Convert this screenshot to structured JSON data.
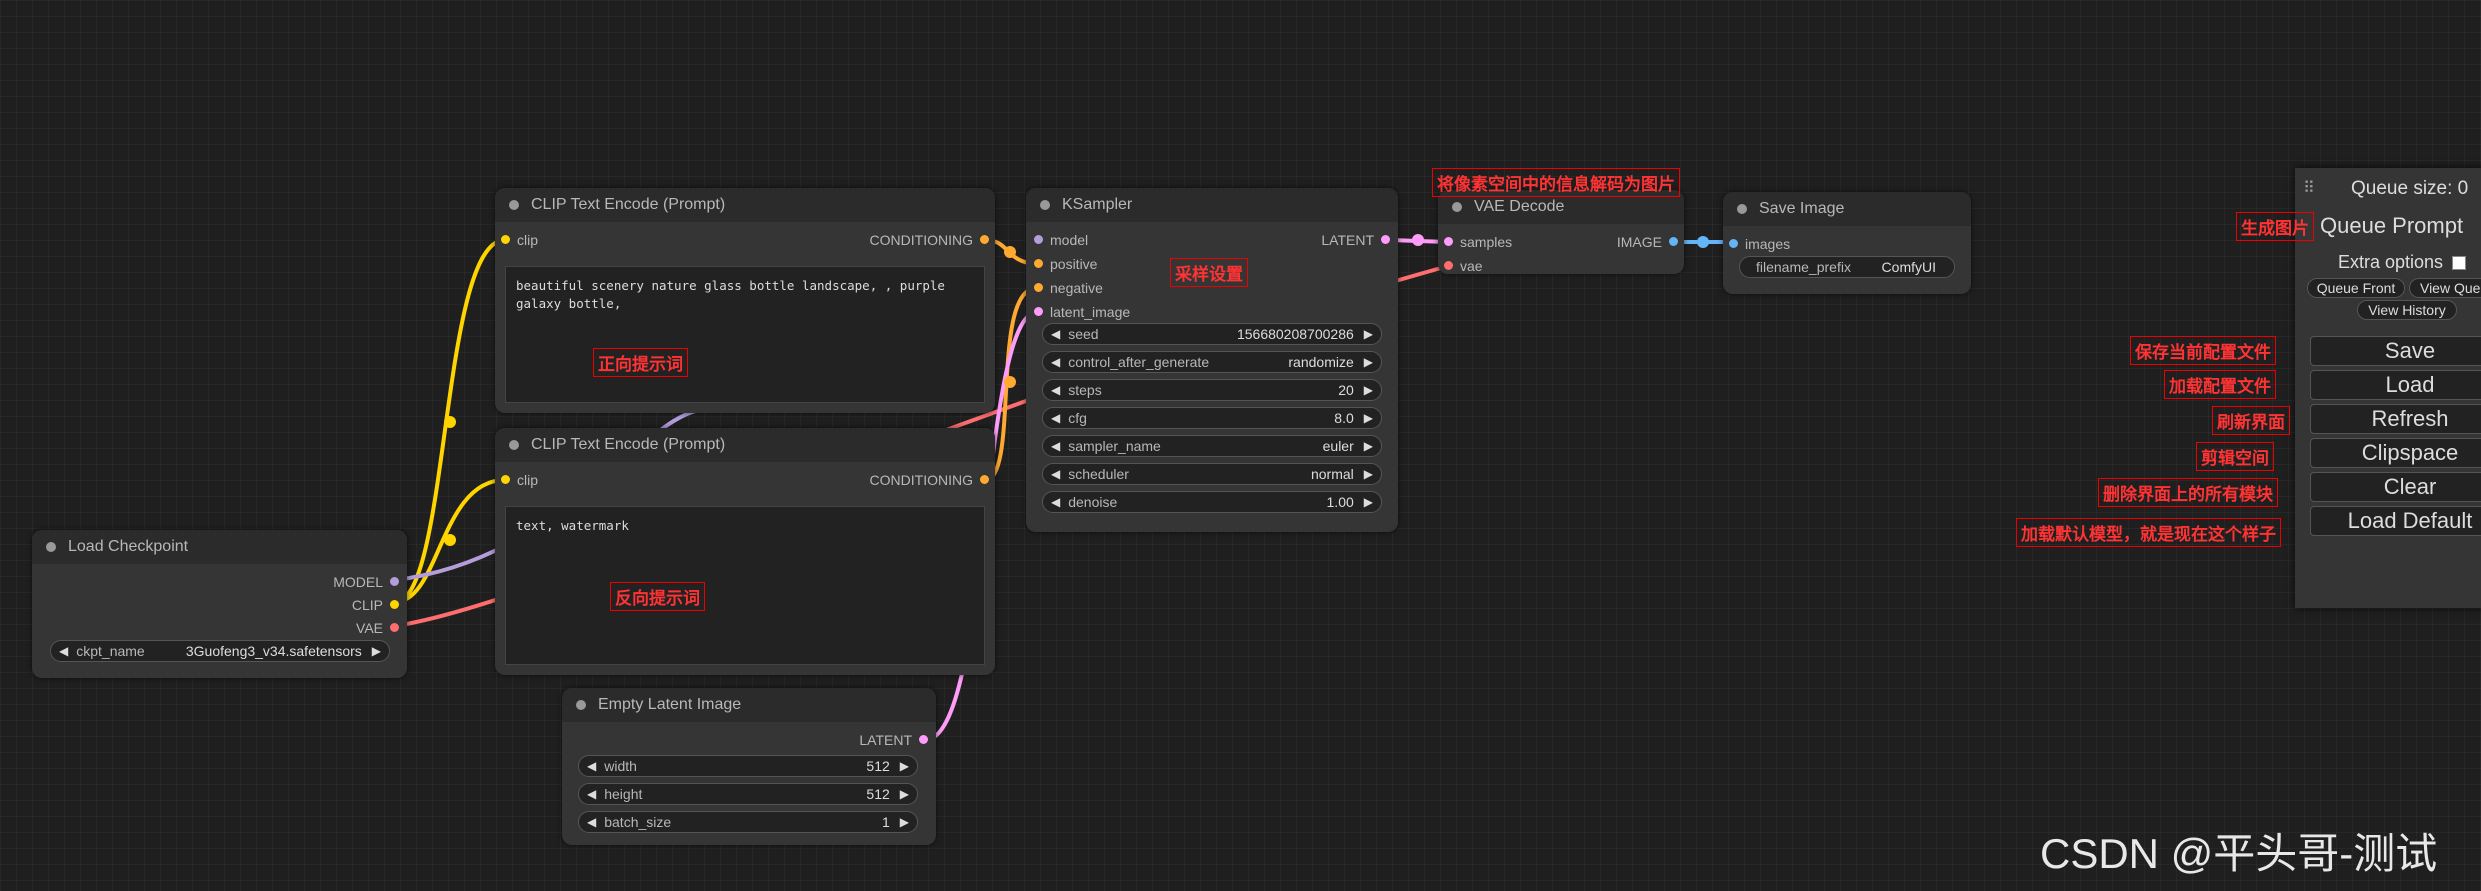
{
  "nodes": {
    "load_checkpoint": {
      "title": "Load Checkpoint",
      "outputs": [
        "MODEL",
        "CLIP",
        "VAE"
      ],
      "ckpt_label": "ckpt_name",
      "ckpt_value": "3Guofeng3_v34.safetensors"
    },
    "clip_pos": {
      "title": "CLIP Text Encode (Prompt)",
      "input": "clip",
      "output": "CONDITIONING",
      "text": "beautiful scenery nature glass bottle landscape, , purple galaxy bottle,"
    },
    "clip_neg": {
      "title": "CLIP Text Encode (Prompt)",
      "input": "clip",
      "output": "CONDITIONING",
      "text": "text, watermark"
    },
    "ksampler": {
      "title": "KSampler",
      "inputs": [
        "model",
        "positive",
        "negative",
        "latent_image"
      ],
      "output": "LATENT",
      "widgets": [
        {
          "label": "seed",
          "value": "156680208700286"
        },
        {
          "label": "control_after_generate",
          "value": "randomize"
        },
        {
          "label": "steps",
          "value": "20"
        },
        {
          "label": "cfg",
          "value": "8.0"
        },
        {
          "label": "sampler_name",
          "value": "euler"
        },
        {
          "label": "scheduler",
          "value": "normal"
        },
        {
          "label": "denoise",
          "value": "1.00"
        }
      ]
    },
    "vae_decode": {
      "title": "VAE Decode",
      "inputs": [
        "samples",
        "vae"
      ],
      "output": "IMAGE"
    },
    "save_image": {
      "title": "Save Image",
      "input": "images",
      "prefix_label": "filename_prefix",
      "prefix_value": "ComfyUI"
    },
    "empty_latent": {
      "title": "Empty Latent Image",
      "output": "LATENT",
      "widgets": [
        {
          "label": "width",
          "value": "512"
        },
        {
          "label": "height",
          "value": "512"
        },
        {
          "label": "batch_size",
          "value": "1"
        }
      ]
    }
  },
  "panel": {
    "queue_size": "Queue size: 0",
    "queue_prompt": "Queue Prompt",
    "extra_options": "Extra options",
    "queue_front": "Queue Front",
    "view_queue": "View Queue",
    "view_history": "View History",
    "save": "Save",
    "load": "Load",
    "refresh": "Refresh",
    "clipspace": "Clipspace",
    "clear": "Clear",
    "load_default": "Load Default"
  },
  "annotations": {
    "positive_prompt": "正向提示词",
    "negative_prompt": "反向提示词",
    "sampler_settings": "采样设置",
    "vae_decode_note": "将像素空间中的信息解码为图片",
    "generate_image": "生成图片",
    "save_config": "保存当前配置文件",
    "load_config": "加载配置文件",
    "refresh_ui": "刷新界面",
    "clipspace_note": "剪辑空间",
    "clear_note": "删除界面上的所有模块",
    "load_default_note": "加载默认模型，就是现在这个样子"
  },
  "watermark": "CSDN @平头哥-测试",
  "colors": {
    "model": "#b39ddb",
    "clip": "#ffd500",
    "vae": "#ff6e6e",
    "conditioning": "#ffa931",
    "latent": "#ff9cf9",
    "image": "#64b5f6",
    "annotation": "#e00000"
  }
}
